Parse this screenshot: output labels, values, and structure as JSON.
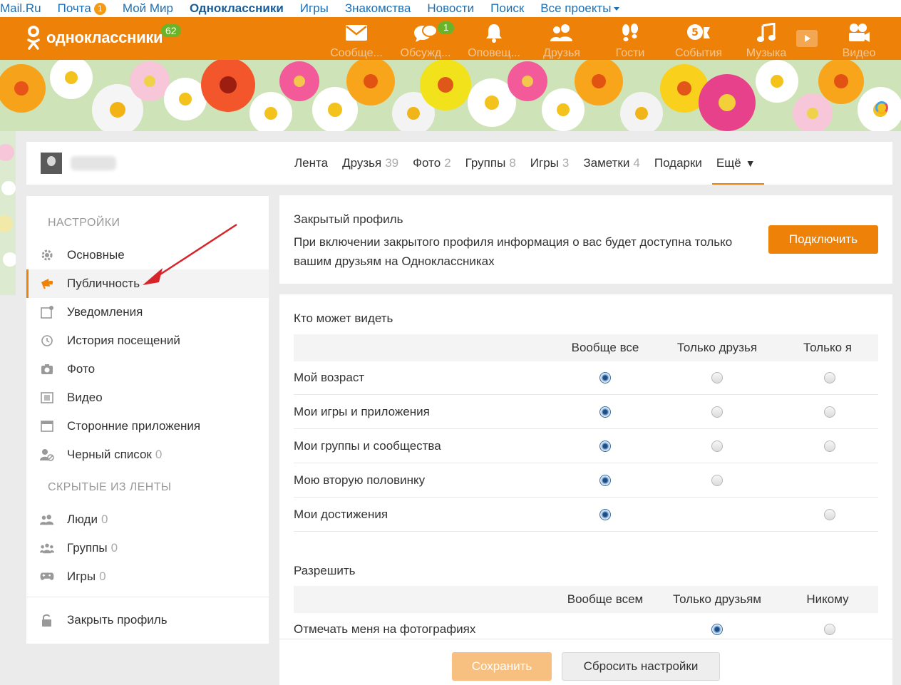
{
  "portal": {
    "links": [
      "Mail.Ru",
      "Почта",
      "Мой Мир",
      "Одноклассники",
      "Игры",
      "Знакомства",
      "Новости",
      "Поиск",
      "Все проекты"
    ],
    "mail_badge": "1"
  },
  "header": {
    "logo_text": "одноклассники",
    "logo_badge": "62",
    "nav": [
      {
        "label": "Сообще...",
        "icon": "envelope-icon"
      },
      {
        "label": "Обсужд...",
        "icon": "discussions-icon",
        "badge": "1"
      },
      {
        "label": "Оповещ...",
        "icon": "bell-icon"
      },
      {
        "label": "Друзья",
        "icon": "friends-icon"
      },
      {
        "label": "Гости",
        "icon": "footprints-icon"
      },
      {
        "label": "События",
        "icon": "events-icon"
      },
      {
        "label": "Музыка",
        "icon": "music-icon"
      },
      {
        "label": "Видео",
        "icon": "video-icon"
      }
    ],
    "accent": "#ee8208"
  },
  "profile": {
    "tabs": [
      {
        "label": "Лента",
        "count": ""
      },
      {
        "label": "Друзья",
        "count": "39"
      },
      {
        "label": "Фото",
        "count": "2"
      },
      {
        "label": "Группы",
        "count": "8"
      },
      {
        "label": "Игры",
        "count": "3"
      },
      {
        "label": "Заметки",
        "count": "4"
      },
      {
        "label": "Подарки",
        "count": ""
      },
      {
        "label": "Ещё",
        "count": ""
      }
    ]
  },
  "settings": {
    "title": "НАСТРОЙКИ",
    "items": [
      {
        "label": "Основные",
        "icon": "gear-icon"
      },
      {
        "label": "Публичность",
        "icon": "megaphone-icon"
      },
      {
        "label": "Уведомления",
        "icon": "notification-icon"
      },
      {
        "label": "История посещений",
        "icon": "history-icon"
      },
      {
        "label": "Фото",
        "icon": "camera-icon"
      },
      {
        "label": "Видео",
        "icon": "film-icon"
      },
      {
        "label": "Сторонние приложения",
        "icon": "app-window-icon"
      },
      {
        "label": "Черный список",
        "icon": "blocked-user-icon",
        "count": "0"
      }
    ],
    "hidden_title": "СКРЫТЫЕ ИЗ ЛЕНТЫ",
    "hidden_items": [
      {
        "label": "Люди",
        "icon": "people-icon",
        "count": "0"
      },
      {
        "label": "Группы",
        "icon": "groups-icon",
        "count": "0"
      },
      {
        "label": "Игры",
        "icon": "gamepad-icon",
        "count": "0"
      }
    ],
    "close_profile": {
      "label": "Закрыть профиль",
      "icon": "lock-icon"
    }
  },
  "closed_profile": {
    "title": "Закрытый профиль",
    "description": "При включении закрытого профиля информация о вас будет доступна только вашим друзьям на Одноклассниках",
    "button": "Подключить"
  },
  "privacy": {
    "who_title": "Кто может видеть",
    "who_columns": [
      "Вообще все",
      "Только друзья",
      "Только я"
    ],
    "who_rows": [
      {
        "label": "Мой возраст",
        "options": [
          true,
          true,
          true
        ],
        "selected": 0
      },
      {
        "label": "Мои игры и приложения",
        "options": [
          true,
          true,
          true
        ],
        "selected": 0
      },
      {
        "label": "Мои группы и сообщества",
        "options": [
          true,
          true,
          true
        ],
        "selected": 0
      },
      {
        "label": "Мою вторую половинку",
        "options": [
          true,
          true,
          false
        ],
        "selected": 0
      },
      {
        "label": "Мои достижения",
        "options": [
          true,
          false,
          true
        ],
        "selected": 0
      }
    ],
    "allow_title": "Разрешить",
    "allow_columns": [
      "Вообще всем",
      "Только друзьям",
      "Никому"
    ],
    "allow_rows": [
      {
        "label": "Отмечать меня на фотографиях",
        "options": [
          false,
          true,
          true
        ],
        "selected": 1
      }
    ]
  },
  "footer": {
    "save": "Сохранить",
    "reset": "Сбросить настройки"
  }
}
